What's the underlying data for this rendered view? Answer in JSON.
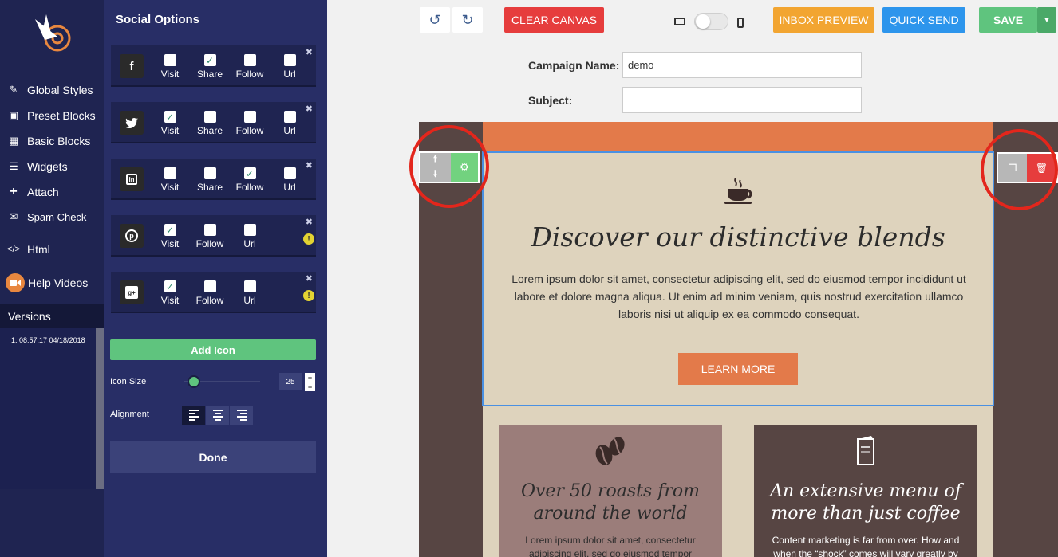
{
  "nav": {
    "items": [
      {
        "label": "Global Styles",
        "icon": "brush-icon"
      },
      {
        "label": "Preset Blocks",
        "icon": "gift-icon"
      },
      {
        "label": "Basic Blocks",
        "icon": "grid-icon"
      },
      {
        "label": "Widgets",
        "icon": "list-icon"
      },
      {
        "label": "Attach",
        "icon": "plus-icon"
      },
      {
        "label": "Spam Check",
        "icon": "envelope-icon"
      },
      {
        "label": "Html",
        "icon": "code-icon"
      },
      {
        "label": "Help Videos",
        "icon": "video-camera-icon"
      }
    ],
    "versions_label": "Versions",
    "versions": [
      "1. 08:57:17 04/18/2018"
    ]
  },
  "panel": {
    "title": "Social Options",
    "rows": [
      {
        "network": "Facebook",
        "glyph": "f",
        "options": [
          {
            "label": "Visit",
            "checked": false
          },
          {
            "label": "Share",
            "checked": true
          },
          {
            "label": "Follow",
            "checked": false
          },
          {
            "label": "Url",
            "checked": false
          }
        ],
        "warning": false
      },
      {
        "network": "Twitter",
        "glyph": "t",
        "options": [
          {
            "label": "Visit",
            "checked": true
          },
          {
            "label": "Share",
            "checked": false
          },
          {
            "label": "Follow",
            "checked": false
          },
          {
            "label": "Url",
            "checked": false
          }
        ],
        "warning": false
      },
      {
        "network": "LinkedIn",
        "glyph": "in",
        "options": [
          {
            "label": "Visit",
            "checked": false
          },
          {
            "label": "Share",
            "checked": false
          },
          {
            "label": "Follow",
            "checked": true
          },
          {
            "label": "Url",
            "checked": false
          }
        ],
        "warning": false
      },
      {
        "network": "Pinterest",
        "glyph": "p",
        "options": [
          {
            "label": "Visit",
            "checked": true
          },
          {
            "label": "Follow",
            "checked": false
          },
          {
            "label": "Url",
            "checked": false
          }
        ],
        "warning": true
      },
      {
        "network": "Google+",
        "glyph": "g+",
        "options": [
          {
            "label": "Visit",
            "checked": true
          },
          {
            "label": "Follow",
            "checked": false
          },
          {
            "label": "Url",
            "checked": false
          }
        ],
        "warning": true
      }
    ],
    "add_icon_label": "Add Icon",
    "icon_size_label": "Icon Size",
    "icon_size_value": "25",
    "alignment_label": "Alignment",
    "alignment_selected": "left",
    "done_label": "Done"
  },
  "toolbar": {
    "undo_icon": "undo-icon",
    "redo_icon": "redo-icon",
    "clear_label": "CLEAR CANVAS",
    "inbox_label": "INBOX PREVIEW",
    "quick_label": "QUICK SEND",
    "save_label": "SAVE",
    "colors": {
      "clear": "#e63d3d",
      "inbox": "#f2a531",
      "quick": "#2d95ec",
      "save": "#5fc47e"
    }
  },
  "campaign": {
    "name_label": "Campaign Name:",
    "name_value": "demo",
    "subject_label": "Subject:",
    "subject_value": ""
  },
  "email": {
    "hero": {
      "title": "Discover our distinctive blends",
      "text": "Lorem ipsum dolor sit amet, consectetur adipiscing elit, sed do eiusmod tempor incididunt ut labore et dolore magna aliqua. Ut enim ad minim veniam, quis nostrud exercitation ullamco laboris nisi ut aliquip ex ea commodo consequat.",
      "button": "LEARN MORE"
    },
    "cards": [
      {
        "title": "Over 50 roasts from around the world",
        "text": "Lorem ipsum dolor sit amet, consectetur adipiscing elit, sed do eiusmod tempor",
        "icon": "coffee-beans-icon"
      },
      {
        "title": "An extensive menu of more than just coffee",
        "text": "Content marketing is far from over. How and when the “shock” comes will vary greatly by",
        "icon": "menu-icon"
      }
    ],
    "colors": {
      "accent": "#e37a4a",
      "background": "#ded3bd",
      "frame": "#574543"
    }
  }
}
